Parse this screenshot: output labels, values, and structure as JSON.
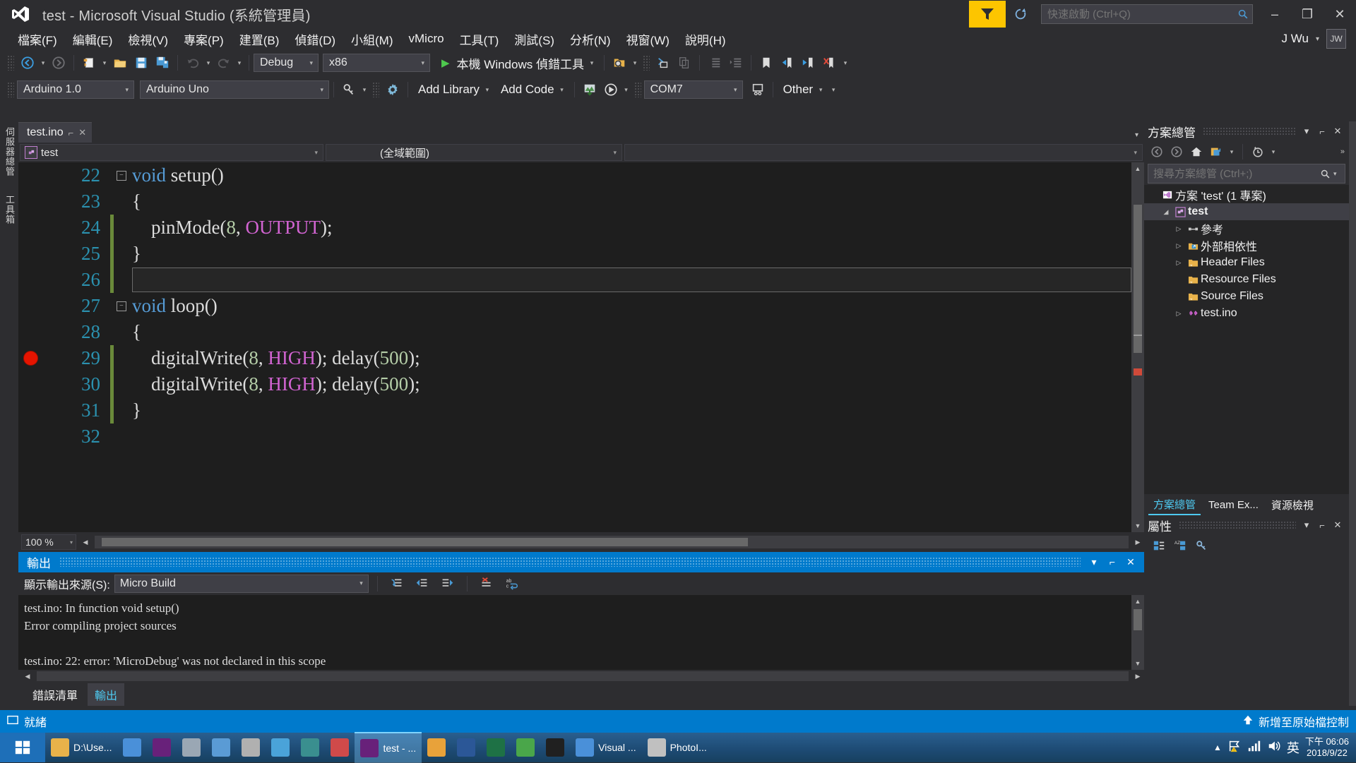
{
  "titlebar": {
    "logo_icon": "visual-studio-logo",
    "title": "test - Microsoft Visual Studio",
    "admin_suffix": "(系統管理員)",
    "feedback_icon": "feedback-funnel-icon",
    "reload_icon": "reload-icon",
    "quick_launch_placeholder": "快速啟動 (Ctrl+Q)",
    "quick_launch_value": "",
    "search_icon": "search-icon",
    "minimize": "–",
    "maximize": "❐",
    "close": "✕"
  },
  "menubar": {
    "items": [
      {
        "label": "檔案(F)"
      },
      {
        "label": "編輯(E)"
      },
      {
        "label": "檢視(V)"
      },
      {
        "label": "專案(P)"
      },
      {
        "label": "建置(B)"
      },
      {
        "label": "偵錯(D)"
      },
      {
        "label": "小組(M)"
      },
      {
        "label": "vMicro"
      },
      {
        "label": "工具(T)"
      },
      {
        "label": "測試(S)"
      },
      {
        "label": "分析(N)"
      },
      {
        "label": "視窗(W)"
      },
      {
        "label": "說明(H)"
      }
    ],
    "user_name": "J Wu",
    "avatar_initials": "JW"
  },
  "toolbar1": {
    "nav_back_icon": "navigate-back-icon",
    "nav_forward_icon": "navigate-forward-icon",
    "new_item_icon": "new-file-icon",
    "open_file_icon": "open-folder-icon",
    "save_icon": "save-icon",
    "save_all_icon": "save-all-icon",
    "undo_icon": "undo-icon",
    "redo_icon": "redo-icon",
    "config_value": "Debug",
    "platform_value": "x86",
    "start_label": "本機 Windows 偵錯工具",
    "start_icon": "play-icon",
    "find_icon": "find-in-files-icon",
    "toggle_icon": "toggle-panel-icon",
    "copy_icon": "copy-icon",
    "indent_icon": "decrease-indent-icon",
    "outdent_icon": "increase-indent-icon",
    "bookmark_icon": "bookmark-icon",
    "prev_bookmark_icon": "previous-bookmark-icon",
    "next_bookmark_icon": "next-bookmark-icon",
    "clear_bookmark_icon": "clear-bookmarks-icon",
    "overflow_icon": "toolbar-overflow-icon"
  },
  "toolbar2": {
    "ide_version_value": "Arduino 1.0",
    "board_value": "Arduino Uno",
    "key_icon": "key-icon",
    "gear_icon": "gear-icon",
    "add_library_label": "Add Library",
    "add_code_label": "Add Code",
    "upload_icon": "upload-icon",
    "debug_icon": "debug-start-icon",
    "port_value": "COM7",
    "monitor_icon": "serial-monitor-icon",
    "other_label": "Other",
    "overflow_icon": "toolbar-overflow-icon"
  },
  "left_rail": {
    "items": [
      {
        "label": "伺服器總管"
      },
      {
        "label": "工具箱"
      }
    ]
  },
  "editor": {
    "tab_label": "test.ino",
    "pin_icon": "pin-icon",
    "close_icon": "close-icon",
    "tabs_dropdown_icon": "chevron-down-icon",
    "nav_scope_icon": "class-icon",
    "nav_type_value": "test",
    "nav_member_value": "(全域範圍)",
    "nav_third_value": "",
    "zoom_value": "100 %",
    "lines": [
      {
        "no": "22",
        "fold": "minus",
        "changed": false,
        "breakpoint": false,
        "selected": false,
        "tokens": [
          {
            "t": "void",
            "c": "kw"
          },
          {
            "t": " setup()",
            "c": "fn"
          }
        ]
      },
      {
        "no": "23",
        "fold": "",
        "changed": false,
        "breakpoint": false,
        "selected": false,
        "tokens": [
          {
            "t": "{",
            "c": "fn"
          }
        ]
      },
      {
        "no": "24",
        "fold": "",
        "changed": true,
        "breakpoint": false,
        "selected": false,
        "tokens": [
          {
            "t": "    pinMode(",
            "c": "fn"
          },
          {
            "t": "8",
            "c": "num"
          },
          {
            "t": ", ",
            "c": "fn"
          },
          {
            "t": "OUTPUT",
            "c": "macro"
          },
          {
            "t": ");",
            "c": "fn"
          }
        ]
      },
      {
        "no": "25",
        "fold": "",
        "changed": true,
        "breakpoint": false,
        "selected": false,
        "tokens": [
          {
            "t": "}",
            "c": "fn"
          }
        ]
      },
      {
        "no": "26",
        "fold": "",
        "changed": true,
        "breakpoint": false,
        "selected": true,
        "tokens": [
          {
            "t": "",
            "c": "fn"
          }
        ]
      },
      {
        "no": "27",
        "fold": "minus",
        "changed": false,
        "breakpoint": false,
        "selected": false,
        "tokens": [
          {
            "t": "void",
            "c": "kw"
          },
          {
            "t": " loop()",
            "c": "fn"
          }
        ]
      },
      {
        "no": "28",
        "fold": "",
        "changed": false,
        "breakpoint": false,
        "selected": false,
        "tokens": [
          {
            "t": "{",
            "c": "fn"
          }
        ]
      },
      {
        "no": "29",
        "fold": "",
        "changed": true,
        "breakpoint": true,
        "selected": false,
        "tokens": [
          {
            "t": "    digitalWrite(",
            "c": "fn"
          },
          {
            "t": "8",
            "c": "num"
          },
          {
            "t": ", ",
            "c": "fn"
          },
          {
            "t": "HIGH",
            "c": "macro"
          },
          {
            "t": "); delay(",
            "c": "fn"
          },
          {
            "t": "500",
            "c": "num"
          },
          {
            "t": ");",
            "c": "fn"
          }
        ]
      },
      {
        "no": "30",
        "fold": "",
        "changed": true,
        "breakpoint": false,
        "selected": false,
        "tokens": [
          {
            "t": "    digitalWrite(",
            "c": "fn"
          },
          {
            "t": "8",
            "c": "num"
          },
          {
            "t": ", ",
            "c": "fn"
          },
          {
            "t": "HIGH",
            "c": "macro"
          },
          {
            "t": "); delay(",
            "c": "fn"
          },
          {
            "t": "500",
            "c": "num"
          },
          {
            "t": ");",
            "c": "fn"
          }
        ]
      },
      {
        "no": "31",
        "fold": "",
        "changed": true,
        "breakpoint": false,
        "selected": false,
        "tokens": [
          {
            "t": "}",
            "c": "fn"
          }
        ]
      },
      {
        "no": "32",
        "fold": "",
        "changed": false,
        "breakpoint": false,
        "selected": false,
        "tokens": [
          {
            "t": "",
            "c": "fn"
          }
        ]
      }
    ]
  },
  "output": {
    "title": "輸出",
    "dropdown_icon": "chevron-down-icon",
    "pin_icon": "pin-icon",
    "close_icon": "close-icon",
    "source_label": "顯示輸出來源(S):",
    "source_value": "Micro Build",
    "btn_goto_icon": "go-to-message-icon",
    "btn_prev_icon": "previous-message-icon",
    "btn_next_icon": "next-message-icon",
    "btn_clear_icon": "clear-all-icon",
    "btn_wrap_icon": "word-wrap-icon",
    "lines": [
      "test.ino: In function void setup()",
      "Error compiling project sources",
      "",
      "test.ino: 22: error: 'MicroDebug' was not declared in this scope"
    ],
    "tabs": [
      {
        "label": "錯誤清單",
        "active": false
      },
      {
        "label": "輸出",
        "active": true
      }
    ]
  },
  "solution_explorer": {
    "title": "方案總管",
    "dropdown_icon": "chevron-down-icon",
    "pin_icon": "pin-icon",
    "close_icon": "close-icon",
    "back_icon": "back-icon",
    "forward_icon": "forward-icon",
    "home_icon": "home-icon",
    "sync_icon": "sync-with-active-document-icon",
    "pending_changes_icon": "pending-changes-icon",
    "overflow_icon": "overflow-icon",
    "search_placeholder": "搜尋方案總管 (Ctrl+;)",
    "search_value": "",
    "search_icon": "search-icon",
    "search_dropdown_icon": "chevron-down-icon",
    "tree": [
      {
        "label": "方案 'test' (1 專案)",
        "indent": 0,
        "expander": "",
        "icon": "solution-icon",
        "selected": false,
        "bold": false
      },
      {
        "label": "test",
        "indent": 1,
        "expander": "expanded",
        "icon": "project-icon",
        "selected": true,
        "bold": true
      },
      {
        "label": "參考",
        "indent": 2,
        "expander": "collapsed",
        "icon": "references-icon",
        "selected": false,
        "bold": false
      },
      {
        "label": "外部相依性",
        "indent": 2,
        "expander": "collapsed",
        "icon": "external-deps-icon",
        "selected": false,
        "bold": false
      },
      {
        "label": "Header Files",
        "indent": 2,
        "expander": "collapsed",
        "icon": "folder-filter-icon",
        "selected": false,
        "bold": false
      },
      {
        "label": "Resource Files",
        "indent": 2,
        "expander": "",
        "icon": "folder-filter-icon",
        "selected": false,
        "bold": false
      },
      {
        "label": "Source Files",
        "indent": 2,
        "expander": "",
        "icon": "folder-filter-icon",
        "selected": false,
        "bold": false
      },
      {
        "label": "test.ino",
        "indent": 2,
        "expander": "collapsed",
        "icon": "ino-file-icon",
        "selected": false,
        "bold": false
      }
    ],
    "tabs": [
      {
        "label": "方案總管",
        "active": true
      },
      {
        "label": "Team Ex...",
        "active": false
      },
      {
        "label": "資源檢視",
        "active": false
      }
    ]
  },
  "properties": {
    "title": "屬性",
    "dropdown_icon": "chevron-down-icon",
    "pin_icon": "pin-icon",
    "close_icon": "close-icon",
    "categorized_icon": "categorized-icon",
    "alphabetical_icon": "alphabetical-icon",
    "properties_icon": "property-pages-icon"
  },
  "statusbar": {
    "ready_icon": "ready-icon",
    "ready_text": "就緒",
    "source_control_icon": "up-arrow-icon",
    "source_control_text": "新增至原始檔控制"
  },
  "taskbar": {
    "start_icon": "windows-start-icon",
    "items": [
      {
        "icon": "folder-icon",
        "label": "D:\\Use...",
        "active": false,
        "color": "#e8b24a"
      },
      {
        "icon": "chrome-icon",
        "label": "",
        "active": false,
        "color": "#4a90d9"
      },
      {
        "icon": "vs-icon",
        "label": "",
        "active": false,
        "color": "#68217a"
      },
      {
        "icon": "app-icon",
        "label": "",
        "active": false,
        "color": "#9aa7b4"
      },
      {
        "icon": "notepad-icon",
        "label": "",
        "active": false,
        "color": "#5a9bd5"
      },
      {
        "icon": "calculator-icon",
        "label": "",
        "active": false,
        "color": "#b0b0b0"
      },
      {
        "icon": "search-tool-icon",
        "label": "",
        "active": false,
        "color": "#4aa3d9"
      },
      {
        "icon": "arduino32-icon",
        "label": "",
        "active": false,
        "color": "#3a8f8f"
      },
      {
        "icon": "bug-icon",
        "label": "",
        "active": false,
        "color": "#d04a4a"
      },
      {
        "icon": "vs-window-icon",
        "label": "test - ...",
        "active": true,
        "color": "#68217a"
      },
      {
        "icon": "export-icon",
        "label": "",
        "active": false,
        "color": "#e8a23a"
      },
      {
        "icon": "word-icon",
        "label": "",
        "active": false,
        "color": "#2b5797"
      },
      {
        "icon": "excel-icon",
        "label": "",
        "active": false,
        "color": "#1e7145"
      },
      {
        "icon": "utorrent-icon",
        "label": "",
        "active": false,
        "color": "#4aa64a"
      },
      {
        "icon": "terminal-icon",
        "label": "",
        "active": false,
        "color": "#202020"
      },
      {
        "icon": "chrome-icon",
        "label": "Visual ...",
        "active": false,
        "color": "#4a90d9"
      },
      {
        "icon": "camera-icon",
        "label": "PhotoI...",
        "active": false,
        "color": "#c0c0c0"
      }
    ],
    "tray": {
      "expand_icon": "show-hidden-icons-icon",
      "flag_icon": "action-center-warning-icon",
      "network_icon": "network-signal-icon",
      "volume_icon": "volume-icon",
      "ime_label": "英",
      "time": "下午 06:06",
      "date": "2018/9/22"
    }
  },
  "colors": {
    "accent_blue": "#007acc",
    "titlebar_bg": "#2d2d30",
    "editor_bg": "#1e1e1e",
    "keyword": "#569cd6",
    "macro": "#d264d2",
    "number": "#b5cea8",
    "linenumber": "#2b91af",
    "breakpoint_red": "#e51400",
    "change_green": "#6a8a3a",
    "feedback_yellow": "#fdc500"
  }
}
